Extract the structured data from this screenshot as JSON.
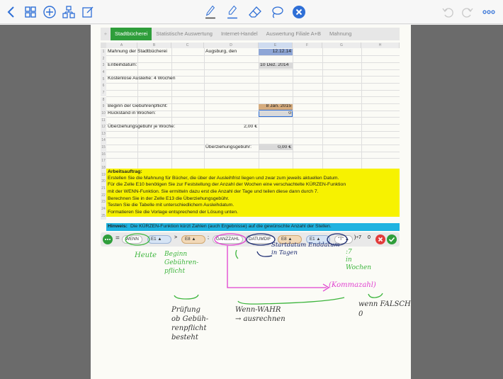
{
  "toolbar": {
    "left_icons": [
      "back-chevron-icon",
      "grid-icon",
      "add-circle-icon",
      "shapes-icon",
      "edit-square-icon"
    ],
    "tool_icons": [
      "pen-icon",
      "highlighter-icon",
      "eraser-icon",
      "lasso-icon",
      "close-circle-icon"
    ],
    "right_icons": [
      "undo-icon",
      "redo-icon",
      "more-icon"
    ]
  },
  "sheet": {
    "tabs": [
      "Stadtbücherei",
      "Statistische Auswertung",
      "Internet-Handel",
      "Auswertung Filiale A+B",
      "Mahnung"
    ],
    "plus": "+",
    "columns": [
      "A",
      "B",
      "C",
      "D",
      "E",
      "F",
      "G",
      "H"
    ],
    "rows": [
      "1",
      "2",
      "3",
      "4",
      "5",
      "6",
      "7",
      "8",
      "9",
      "10",
      "11",
      "12",
      "13",
      "14",
      "15",
      "16",
      "17",
      "18",
      "19",
      "20",
      "21",
      "22",
      "23",
      "24",
      "25"
    ],
    "cells": {
      "a1": "Mahnung der Stadtbücherei",
      "d1": "Augsburg, den",
      "e1": "12.12.14",
      "a3": "Entleihdatum:",
      "e3": "10 Dez. 2014",
      "a5": "Kostenlose Ausleihe: 4 Wochen",
      "a9": "Beginn der Gebührenpflicht:",
      "e9": "8 Jan. 2015",
      "a10": "Rückstand in Wochen:",
      "e10": "0",
      "a12": "Überziehungsgebühr je Woche:",
      "d12": "2,00 €",
      "d14": "Überziehungsgebühr:",
      "e14": "0,00 €"
    },
    "task": {
      "title": "Arbeitsauftrag:",
      "lines": [
        "Erstellen Sie die Mahnung für Bücher, die über der Ausleihfrist liegen und zwar zum jeweils aktuellen Datum.",
        "Für die Zelle E10 benötigen Sie zur Feststellung der Anzahl der Wochen eine verschachtelte KÜRZEN-Funktion",
        "mit der WENN-Funktion. Sie ermitteln dazu erst die Anzahl der Tage und teilen diese dann durch 7.",
        "Berechnen Sie in der Zelle E13 die Überziehungsgebühr.",
        "Testen Sie die Tabelle mit unterschiedlichem Ausleihdatum.",
        "Formatieren Sie die Vorlage entsprechend der Lösung unten."
      ]
    },
    "hint_label": "Hinweis:",
    "hint": "Die KÜRZEN-Funktion kürzt Zahlen (auch Ergebnisse) auf die gewünschte Anzahl der Stellen."
  },
  "formula": {
    "eq": "=",
    "wenn": "WENN",
    "e1": "E1",
    "gt": ">",
    "e8": "E8",
    "sep1": ";",
    "ganzzahl": "GANZZAHL",
    "datumdif": "DATUMDIF",
    "e8b": "E8",
    "e1b": "E1",
    "t": "\"T\"",
    "div7": ")÷7",
    "zero": "0",
    "arrow": "▲"
  },
  "handwriting": {
    "heute": "Heute",
    "beginn": "Beginn\nGebühren-\npflicht",
    "startdatum": "Startdatum Enddatum\nin Tagen",
    "inwochen": ":7\nin\nWochen",
    "kommazahl": "(Kommazahl)",
    "pruefung": "Prüfung\nob Gebüh-\nrenpflicht\nbesteht",
    "wennwahr": "Wenn-WAHR\n→ ausrechnen",
    "wennfalsch": "wenn FALSCH\n0"
  },
  "colors": {
    "accent_blue": "#2f6fd6",
    "tab_green": "#2f9e3b",
    "task_yellow": "#f7f200",
    "hint_cyan": "#1fb3e0",
    "ink_green": "#3db53d",
    "ink_magenta": "#e040d0",
    "ink_navy": "#1a2a70",
    "ink_dark": "#333333"
  }
}
